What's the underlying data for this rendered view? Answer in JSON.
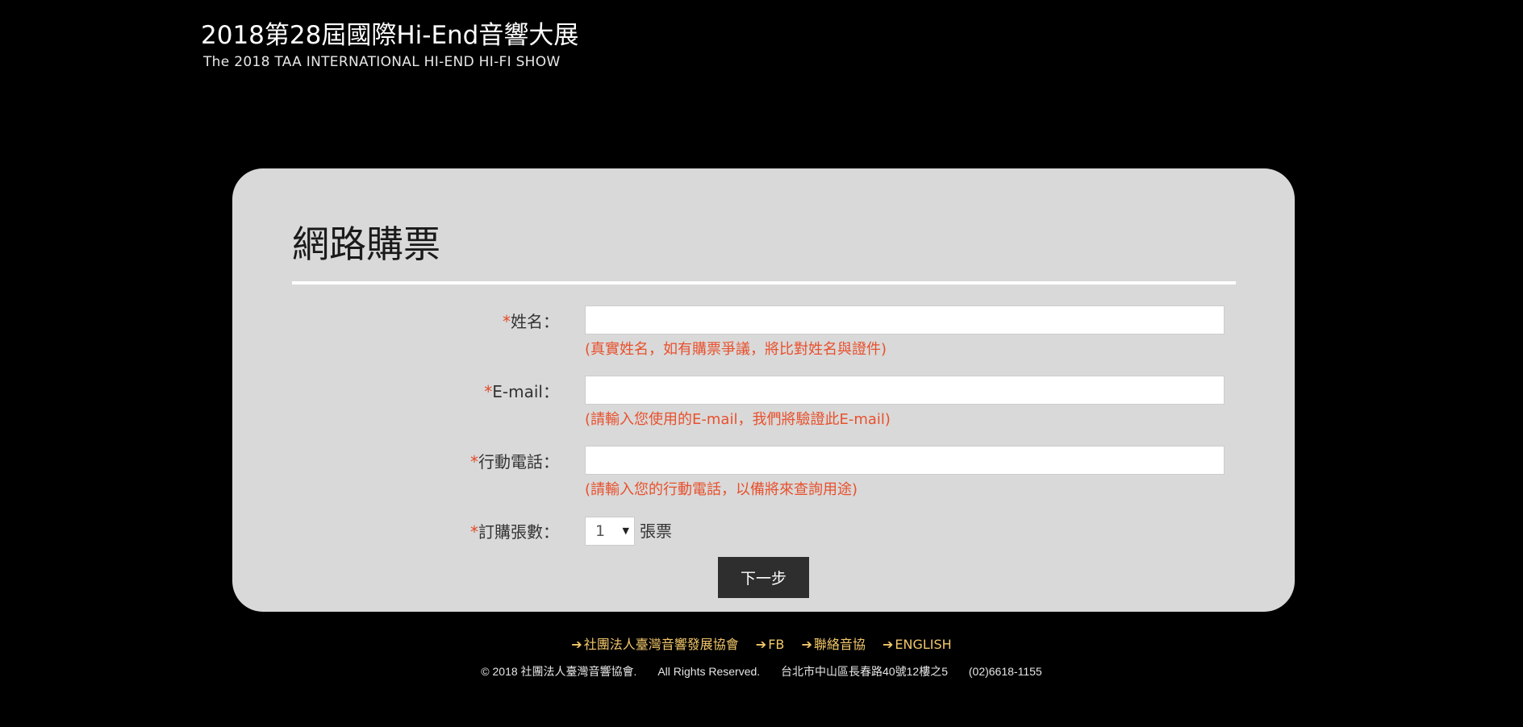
{
  "header": {
    "logo_title": "2018第28屆國際Hi-End音響大展",
    "logo_subtitle": "The 2018 TAA INTERNATIONAL HI-END HI-FI SHOW"
  },
  "form": {
    "title": "網路購票",
    "required_mark": "*",
    "name": {
      "label": "姓名：",
      "value": "",
      "hint": "(真實姓名，如有購票爭議，將比對姓名與證件)"
    },
    "email": {
      "label": "E-mail：",
      "value": "",
      "hint": "(請輸入您使用的E-mail，我們將驗證此E-mail)"
    },
    "phone": {
      "label": "行動電話：",
      "value": "",
      "hint": "(請輸入您的行動電話，以備將來查詢用途)"
    },
    "quantity": {
      "label": "訂購張數：",
      "selected": "1",
      "unit": "張票"
    },
    "next_button": "下一步"
  },
  "footer": {
    "links": [
      {
        "label": "社團法人臺灣音響發展協會"
      },
      {
        "label": "FB"
      },
      {
        "label": "聯絡音協"
      },
      {
        "label": "ENGLISH"
      }
    ],
    "copyright": "© 2018 社團法人臺灣音響協會.",
    "rights": "All Rights Reserved.",
    "address": "台北市中山區長春路40號12樓之5",
    "phone": "(02)6618-1155"
  },
  "colors": {
    "background": "#000000",
    "panel": "#d9d9d9",
    "required": "#e24a2a",
    "hint": "#e8502c",
    "footer_link": "#f2c76a",
    "button": "#2e2e2e"
  }
}
